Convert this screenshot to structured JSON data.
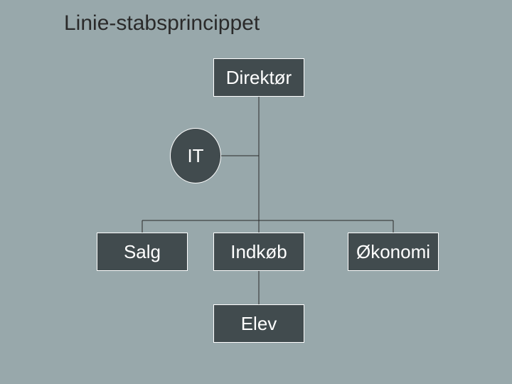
{
  "title": "Linie-stabsprincippet",
  "nodes": {
    "director": "Direktør",
    "staff": "IT",
    "dept1": "Salg",
    "dept2": "Indkøb",
    "dept3": "Økonomi",
    "sub": "Elev"
  },
  "colors": {
    "background": "#98a8ab",
    "node_fill": "#414b4e",
    "node_border": "#ffffff",
    "node_text": "#ffffff",
    "title_text": "#2a2a2a",
    "line": "#2a2a2a"
  }
}
